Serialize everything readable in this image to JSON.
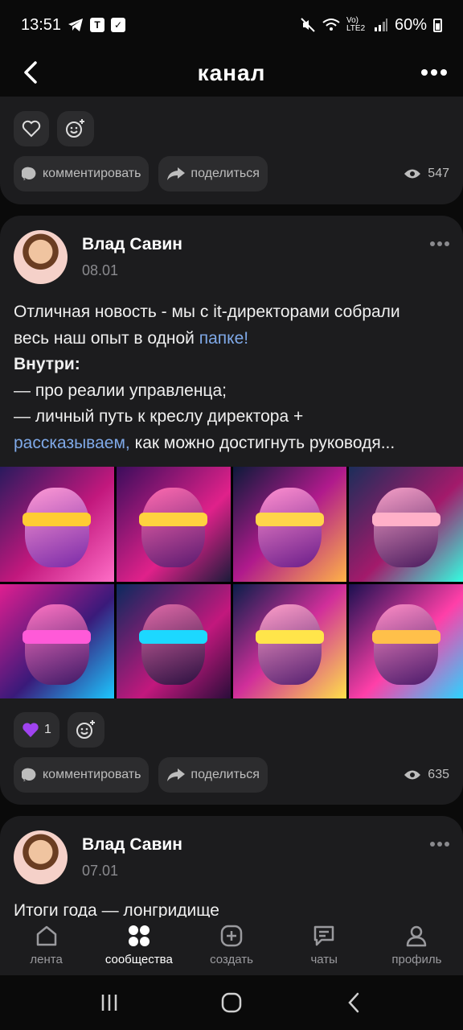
{
  "status_bar": {
    "time": "13:51",
    "network": "Vo) LTE2",
    "battery": "60%"
  },
  "header": {
    "title": "канал"
  },
  "post1": {
    "comment_label": "комментировать",
    "share_label": "поделиться",
    "views": "547"
  },
  "post2": {
    "author": "Влад Савин",
    "date": "08.01",
    "text_line1": "Отличная новость - мы с it-директорами собрали",
    "text_line2_a": "весь наш опыт в одной ",
    "text_line2_link": "папке!",
    "text_line3": "Внутри:",
    "text_line4": "— про реалии управленца;",
    "text_line5": "— личный путь к креслу директора +",
    "text_line6_link": "рассказываем,",
    "text_line6_b": " как можно достигнуть руководя...",
    "reaction_count": "1",
    "comment_label": "комментировать",
    "share_label": "поделиться",
    "views": "635"
  },
  "post3": {
    "author": "Влад Савин",
    "date": "07.01",
    "text_preview": "Итоги года — лонгридище"
  },
  "tabbar": {
    "feed": "лента",
    "communities": "сообщества",
    "create": "создать",
    "chats": "чаты",
    "profile": "профиль"
  },
  "colors": {
    "background": "#0a0a0a",
    "card": "#1c1c1e",
    "button": "#2c2c2e",
    "link": "#7fa9e8",
    "muted": "#8a8a8e"
  }
}
